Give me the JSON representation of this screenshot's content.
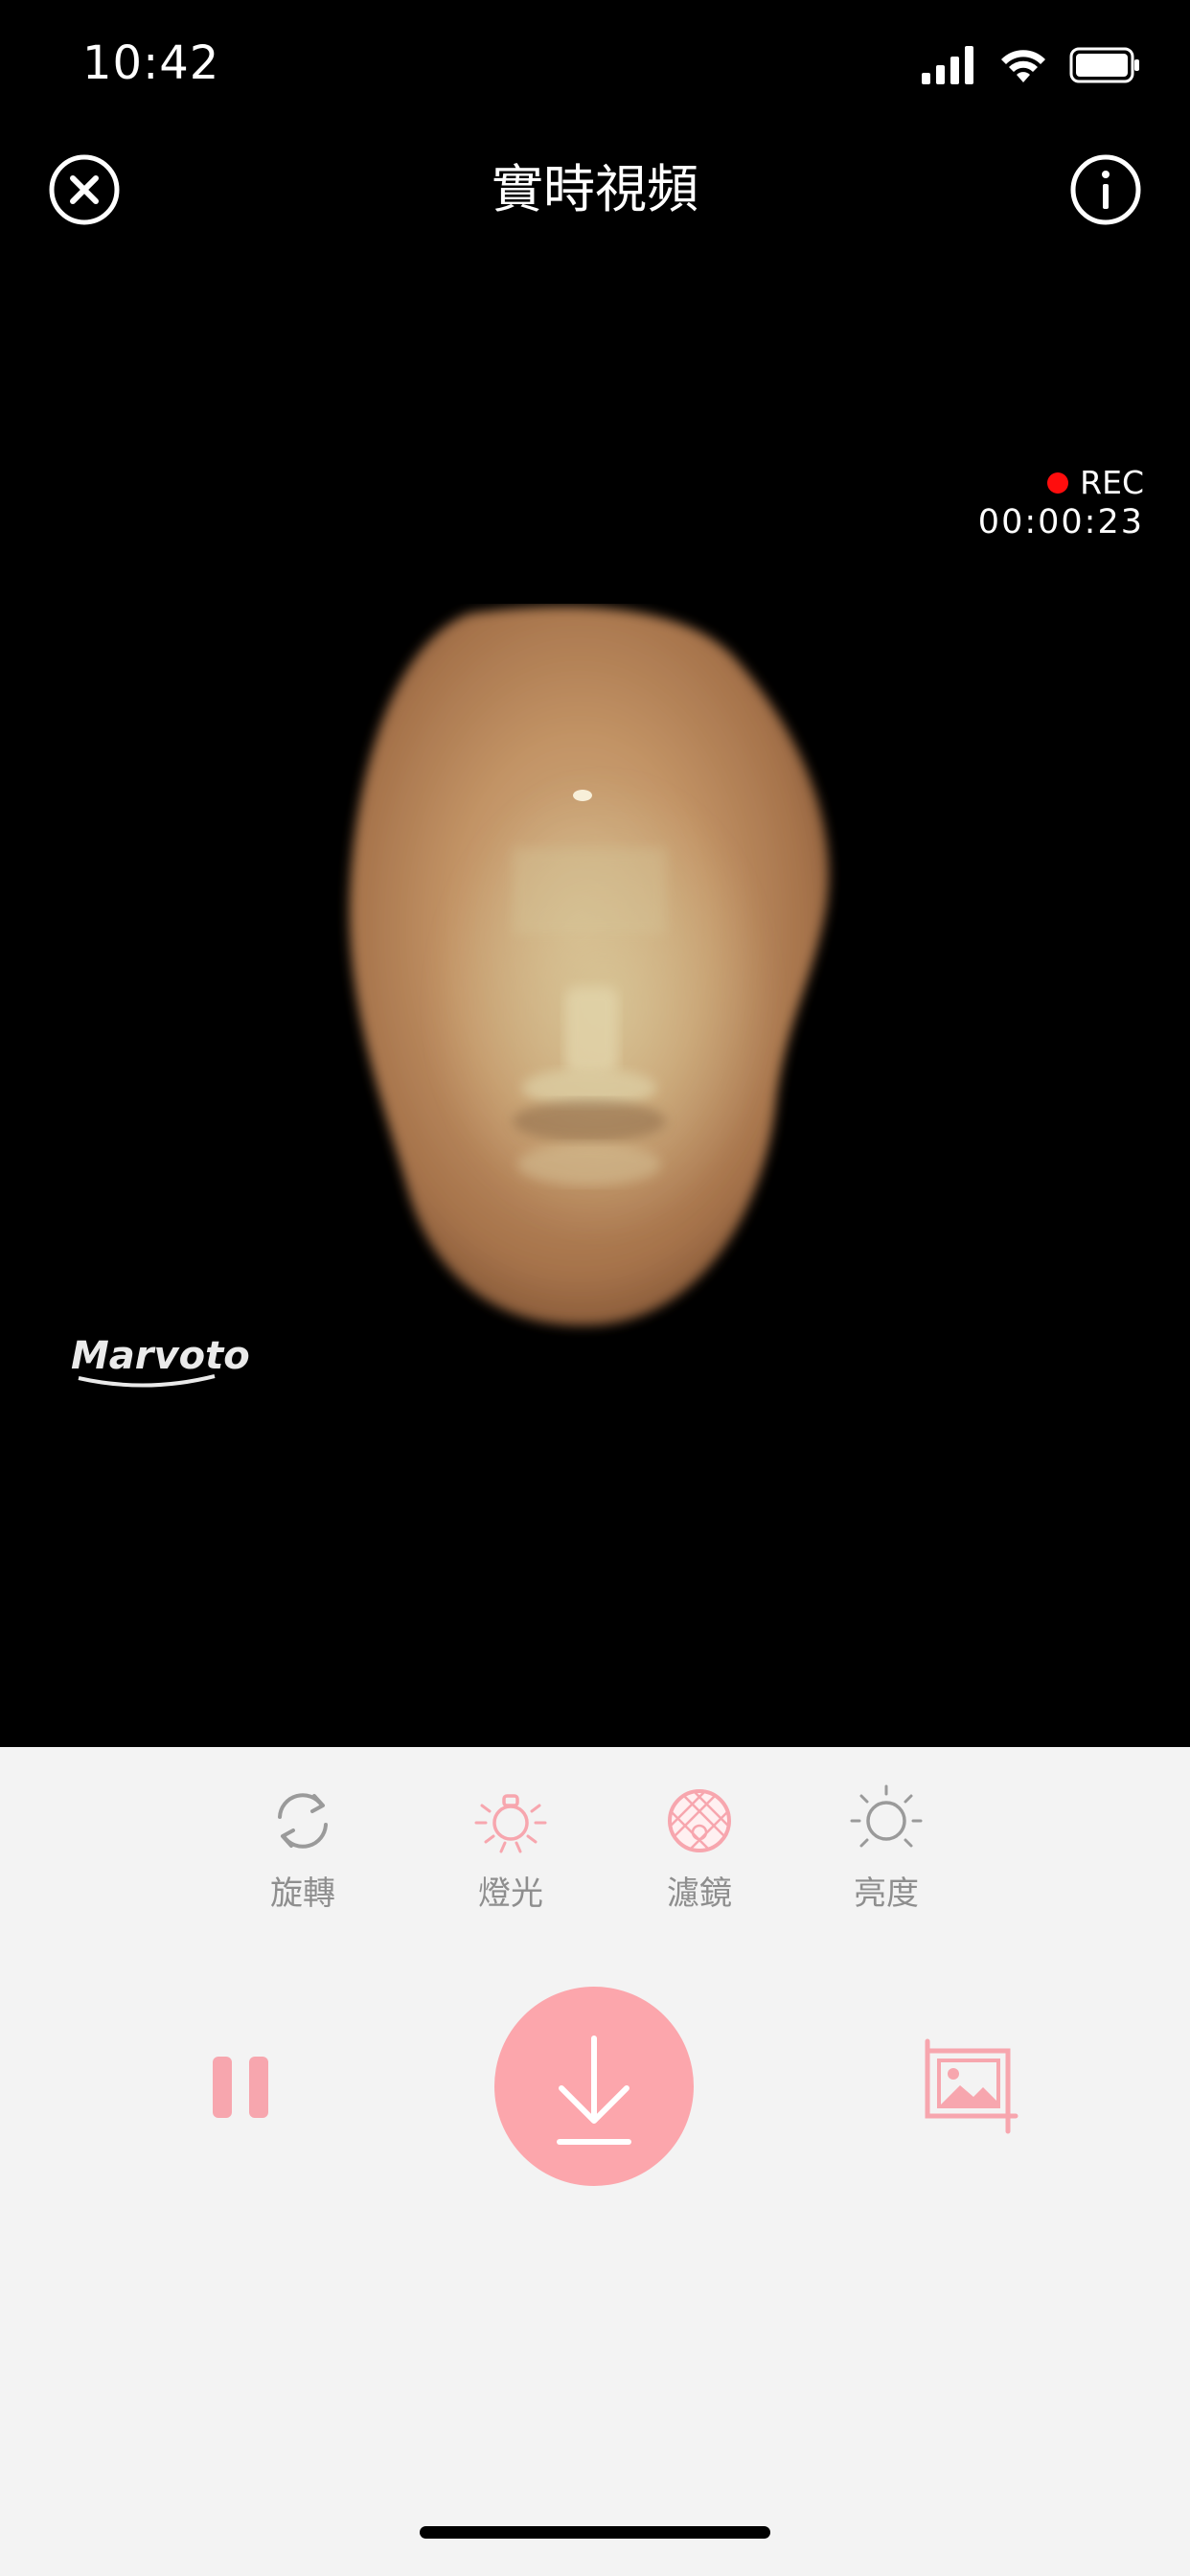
{
  "status_bar": {
    "time": "10:42"
  },
  "header": {
    "title": "實時視頻",
    "close_icon": "close-circle-icon",
    "info_icon": "info-circle-icon"
  },
  "recording": {
    "rec_label": "REC",
    "timer": "00:00:23",
    "indicator_color": "#ff0d0d"
  },
  "video": {
    "watermark": "Marvoto"
  },
  "tools": [
    {
      "label": "旋轉",
      "icon": "rotate-icon"
    },
    {
      "label": "燈光",
      "icon": "light-bulb-icon"
    },
    {
      "label": "濾鏡",
      "icon": "filter-icon"
    },
    {
      "label": "亮度",
      "icon": "brightness-icon"
    }
  ],
  "actions": {
    "pause_icon": "pause-icon",
    "download_icon": "download-icon",
    "crop_icon": "crop-image-icon"
  },
  "colors": {
    "accent": "#fca6ac",
    "tool_icon_gray": "#9a9a9a",
    "panel_bg": "#f3f3f3",
    "video_bg": "#000000"
  }
}
